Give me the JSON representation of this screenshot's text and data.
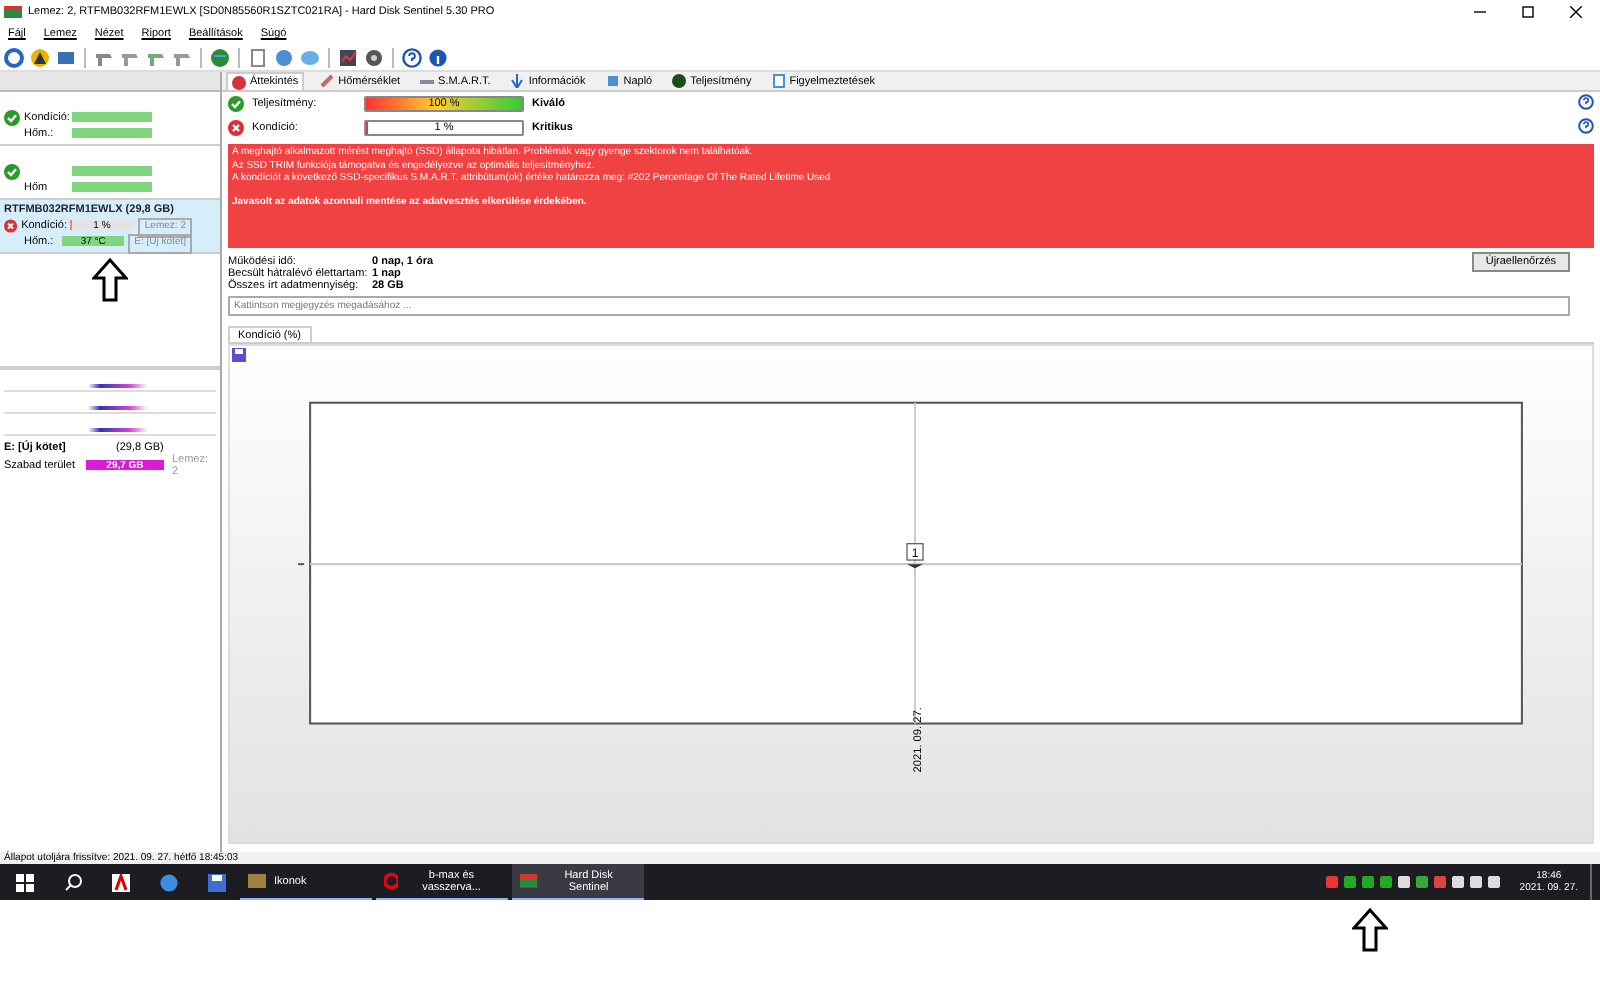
{
  "window": {
    "title": "Lemez: 2, RTFMB032RFM1EWLX [SD0N85560R1SZTC021RA]  -  Hard Disk Sentinel 5.30 PRO"
  },
  "menu": [
    "Fájl",
    "Lemez",
    "Nézet",
    "Riport",
    "Beállítások",
    "Súgó"
  ],
  "disks": [
    {
      "critical": false,
      "selected": false,
      "condition_label": "Kondíció:",
      "condition": {
        "level": 1
      },
      "temp_label": "Hőm.:",
      "temp": {
        "level": 1
      }
    },
    {
      "critical": false,
      "selected": false,
      "temp_label": "Hőm",
      "temp": {
        "level": 1
      },
      "condition": {
        "level": 1
      }
    },
    {
      "name": "RTFMB032RFM1EWLX (29,8 GB)",
      "critical": true,
      "selected": true,
      "condition_label": "Kondíció:",
      "condition": {
        "level": 0.01,
        "reading": "1 %"
      },
      "temp_label": "Hőm.:",
      "temp": {
        "level": 1,
        "reading": "37 °C"
      },
      "disk_note": "Lemez: 2",
      "volume_note": "E: [Új kötet]"
    }
  ],
  "volume": {
    "name": "E: [Új kötet]",
    "size": "(29,8 GB)",
    "free_label": "Szabad terület",
    "free": {
      "level": 1,
      "reading": "29,7 GB"
    },
    "disk_note": "Lemez: 2"
  },
  "tabs": [
    {
      "label": "Áttekintés",
      "selected": true
    },
    {
      "label": "Hőmérséklet",
      "selected": false
    },
    {
      "label": "S.M.A.R.T.",
      "selected": false
    },
    {
      "label": "Információk",
      "selected": false
    },
    {
      "label": "Napló",
      "selected": false
    },
    {
      "label": "Teljesítmény",
      "selected": false
    },
    {
      "label": "Figyelmeztetések",
      "selected": false
    }
  ],
  "metrics": [
    {
      "label": "Teljesítmény:",
      "critical": false,
      "level": 1,
      "reading": "100 %",
      "verdict": "Kiváló"
    },
    {
      "label": "Kondíció:",
      "critical": true,
      "level": 0.01,
      "reading": "1 %",
      "verdict": "Kritikus"
    }
  ],
  "alert": {
    "lines": [
      "A meghajtó alkalmazott mérést meghajtó (SSD) állapota hibátlan. Problémák vagy gyenge szektorok nem találhatóak.",
      "Az SSD TRIM funkciója támogatva és engedélyezve az optimális teljesítményhez.",
      "A kondíciót a következő SSD-specifikus S.M.A.R.T. attribútum(ok) értéke határozza meg:  #202 Percentage Of The Rated Lifetime Used"
    ],
    "advice": "Javasolt az adatok azonnali mentése az adatvesztés elkerülése érdekében."
  },
  "info": [
    {
      "label": "Működési idő:",
      "value": "0 nap, 1 óra"
    },
    {
      "label": "Becsült hátralévő élettartam:",
      "value": "1 nap"
    },
    {
      "label": "Összes írt adatmennyiség:",
      "value": "28 GB"
    }
  ],
  "recheck_button": "Újraellenőrzés",
  "note": {
    "placeholder": "Kattintson megjegyzés megadásához ..."
  },
  "chart_tab": "Kondíció (%)",
  "chart": {
    "point_label": "1",
    "date_label": "2021. 09. 27."
  },
  "status_bar": "Állapot utoljára frissítve: 2021. 09. 27. hétfő 18:45:03",
  "taskbar": {
    "tasks": [
      {
        "label": "Ikonok",
        "selected": false
      },
      {
        "label": "b-max és vasszerva...",
        "selected": false
      },
      {
        "label": "Hard Disk Sentinel",
        "selected": true
      }
    ],
    "time": "18:46",
    "date": "2021. 09. 27."
  }
}
